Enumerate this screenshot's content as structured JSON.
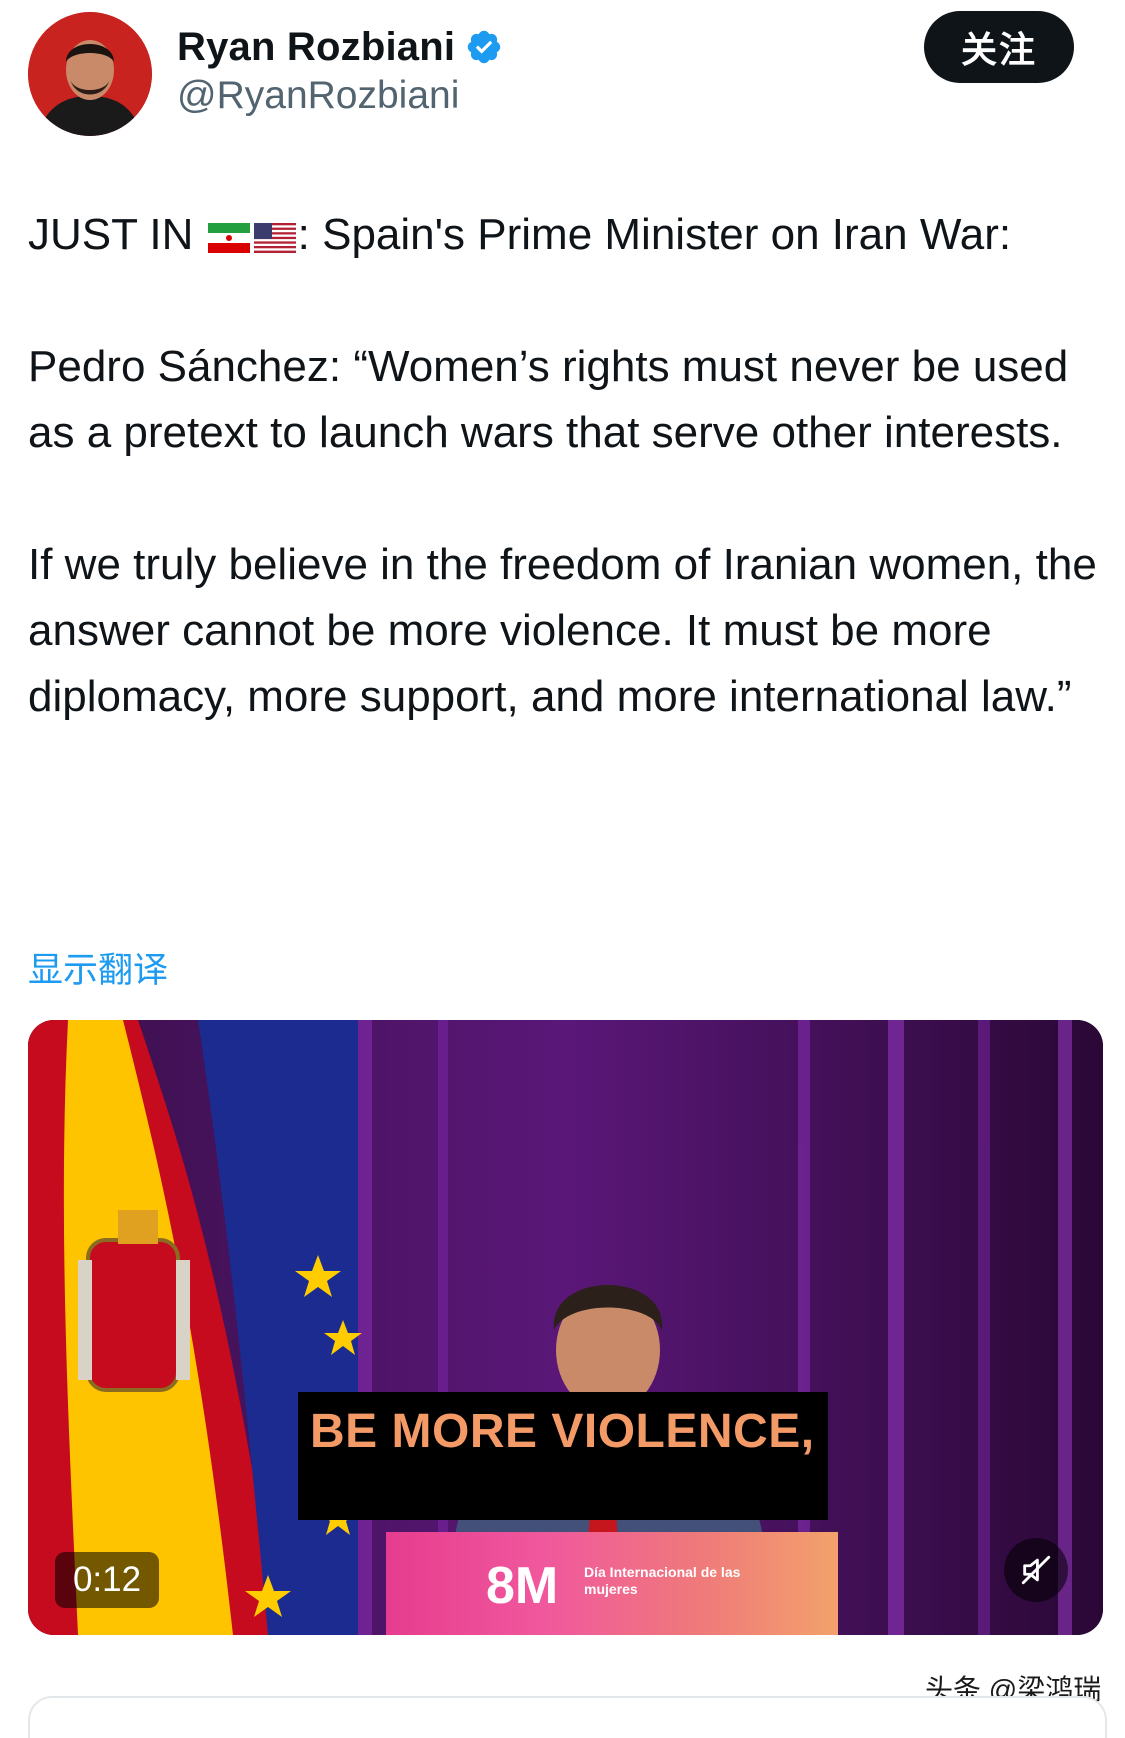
{
  "author": {
    "name": "Ryan Rozbiani",
    "handle": "@RyanRozbiani",
    "verified": true,
    "avatar_icon": "profile-photo"
  },
  "follow_button_label": "关注",
  "tweet": {
    "intro_prefix": "JUST IN ",
    "intro_flags": [
      "iran-flag-icon",
      "us-flag-icon"
    ],
    "intro_suffix": ": Spain's Prime Minister on Iran War:",
    "quote_part1": "Pedro Sánchez: “Women’s rights must never be used as a pretext to launch wars that serve other interests.",
    "quote_part2": "If we truly believe in the freedom of Iranian women, the answer cannot be more violence. It must be more diplomacy, more support, and more international law.”"
  },
  "translate_link": "显示翻译",
  "video": {
    "subtitle": "BE MORE VIOLENCE,",
    "podium_logo": "8M",
    "podium_caption": "Día Internacional de las mujeres",
    "duration": "0:12",
    "mute_icon": "speaker-muted-icon"
  },
  "watermark": "头条 @梁鸿瑞",
  "colors": {
    "link": "#1d9bf0",
    "verified": "#1d9bf0",
    "text": "#0f1419",
    "subtitle": "#f39a67"
  }
}
